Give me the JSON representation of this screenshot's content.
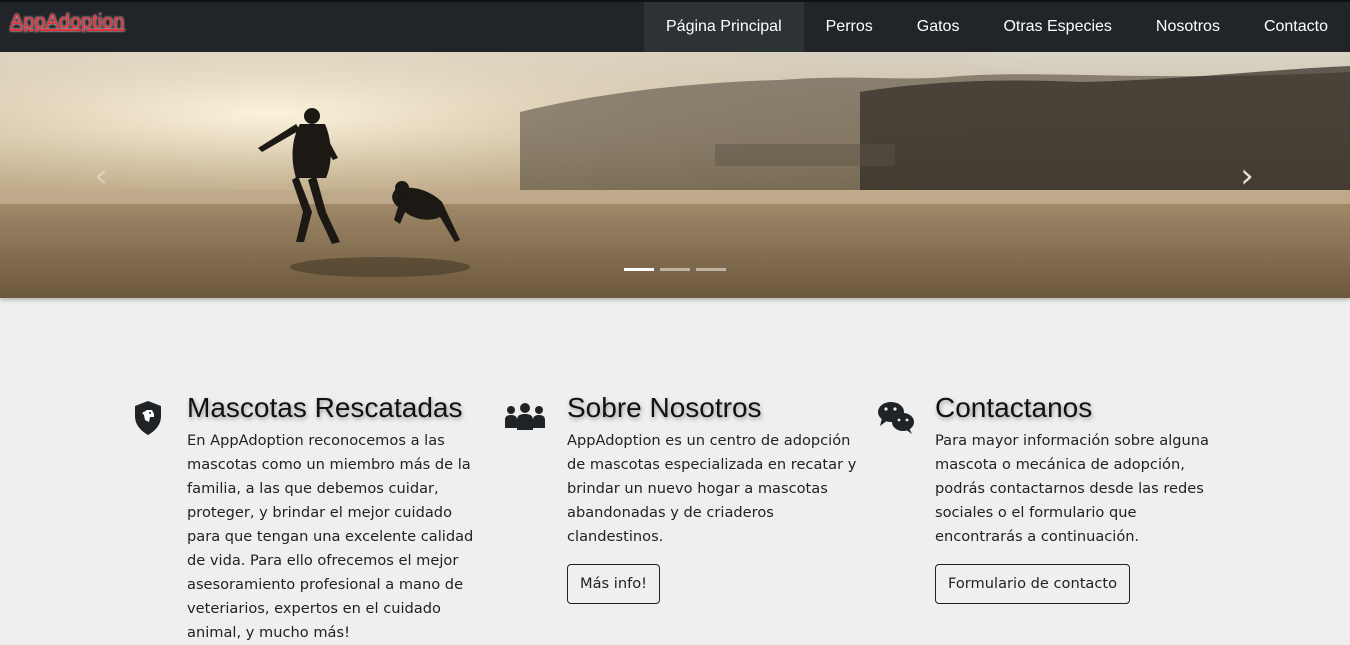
{
  "navbar": {
    "brand": "AppAdoption",
    "links": [
      {
        "label": "Página Principal",
        "active": true
      },
      {
        "label": "Perros",
        "active": false
      },
      {
        "label": "Gatos",
        "active": false
      },
      {
        "label": "Otras Especies",
        "active": false
      },
      {
        "label": "Nosotros",
        "active": false
      },
      {
        "label": "Contacto",
        "active": false
      }
    ]
  },
  "carousel": {
    "prev_icon": "chevron-left-icon",
    "next_icon": "chevron-right-icon",
    "slide_count": 3,
    "active_index": 0
  },
  "features": [
    {
      "icon": "shield-dog-icon",
      "title": "Mascotas Rescatadas",
      "text": "En AppAdoption reconocemos a las mascotas como un miembro más de la familia, a las que debemos cuidar, proteger, y brindar el mejor cuidado para que tengan una excelente calidad de vida. Para ello ofrecemos el mejor asesoramiento profesional a mano de veteriarios, expertos en el cuidado animal, y mucho más!"
    },
    {
      "icon": "people-group-icon",
      "title": "Sobre Nosotros",
      "text": "AppAdoption es un centro de adopción de mascotas especializada en recatar y brindar un nuevo hogar a mascotas abandonadas y de criaderos clandestinos.",
      "button": "Más info!"
    },
    {
      "icon": "chat-bubbles-icon",
      "title": "Contactanos",
      "text": "Para mayor información sobre alguna mascota o mecánica de adopción, podrás contactarnos desde las redes sociales o el formulario que encontrarás a continuación.",
      "button": "Formulario de contacto"
    }
  ]
}
